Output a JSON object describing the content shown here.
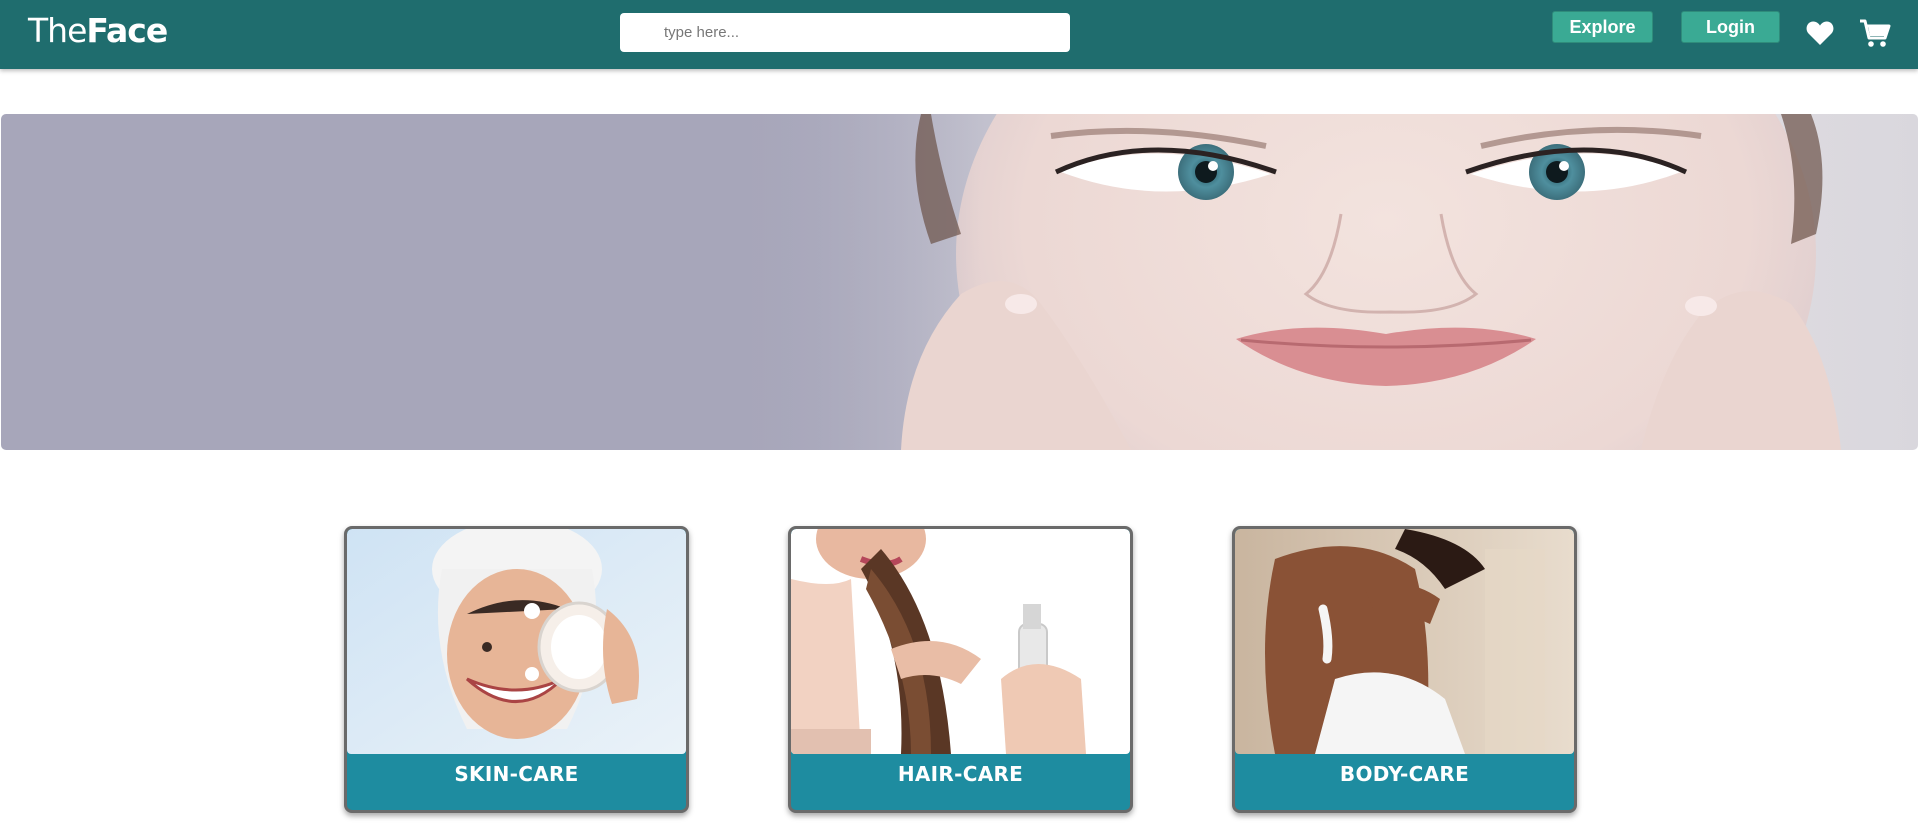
{
  "header": {
    "logo_light": "The",
    "logo_bold": "Face",
    "search_placeholder": "type here...",
    "explore_label": "Explore",
    "login_label": "Login",
    "wishlist_icon": "heart-icon",
    "cart_icon": "cart-icon"
  },
  "colors": {
    "navbar": "#1f6d6e",
    "button": "#3aaa94",
    "card_footer": "#1e8ca0",
    "hero_background": "#a7a6ba"
  },
  "categories": [
    {
      "label": "SKIN-CARE"
    },
    {
      "label": "HAIR-CARE"
    },
    {
      "label": "BODY-CARE"
    }
  ]
}
